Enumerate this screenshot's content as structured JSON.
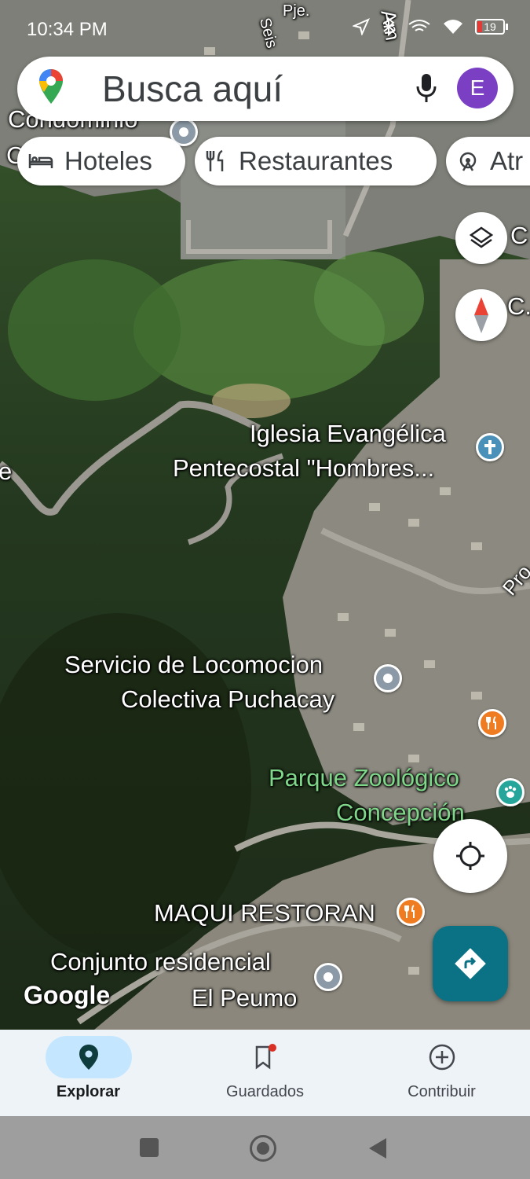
{
  "status": {
    "time": "10:34 PM",
    "battery": "19"
  },
  "search": {
    "placeholder": "Busca aquí",
    "avatar_letter": "E"
  },
  "chips": [
    {
      "label": "Hoteles",
      "icon": "bed-icon"
    },
    {
      "label": "Restaurantes",
      "icon": "fork-knife-icon"
    },
    {
      "label": "Atr",
      "icon": "attractions-icon"
    }
  ],
  "map": {
    "labels": {
      "top_partial_1": "Condominio",
      "top_partial_2": "C",
      "street_partial_pje": "Pje.",
      "street_partial_seis": "Seis",
      "street_partial_am": "Am",
      "side_c1": "C",
      "side_c2": "C.",
      "left_e": "e",
      "iglesia_l1": "Iglesia Evangélica",
      "iglesia_l2": "Pentecostal \"Hombres...",
      "pro": "Pro",
      "servicio_l1": "Servicio de Locomocion",
      "servicio_l2": "Colectiva Puchacay",
      "parque_l1": "Parque Zoológico",
      "parque_l2": "Concepción",
      "maqui": "MAQUI RESTORAN",
      "conjunto_l1": "Conjunto residencial",
      "conjunto_l2": "El Peumo",
      "google": "Google"
    }
  },
  "nav": {
    "items": [
      {
        "label": "Explorar",
        "icon": "location-pin-icon",
        "active": true
      },
      {
        "label": "Guardados",
        "icon": "bookmark-icon",
        "active": false
      },
      {
        "label": "Contribuir",
        "icon": "add-circle-icon",
        "active": false
      }
    ]
  },
  "colors": {
    "accent": "#0b7285",
    "active_nav": "#c4e7ff",
    "avatar": "#7b3fc4"
  }
}
